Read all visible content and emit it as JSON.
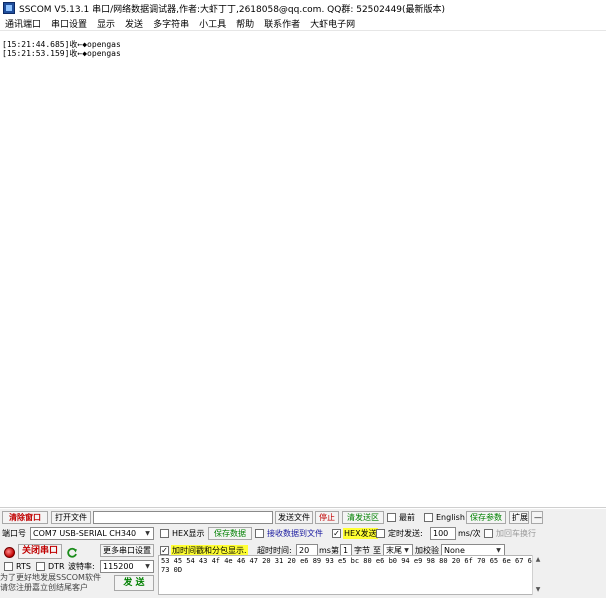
{
  "titlebar": {
    "title": "SSCOM V5.13.1 串口/网络数据调试器,作者:大虾丁丁,2618058@qq.com. QQ群: 52502449(最新版本)"
  },
  "menu": {
    "items": [
      "通讯端口",
      "串口设置",
      "显示",
      "发送",
      "多字符串",
      "小工具",
      "帮助",
      "联系作者",
      "大虾电子网"
    ]
  },
  "receive": {
    "lines": [
      "[15:21:44.685]收←◆opengas",
      "[15:21:53.159]收←◆opengas"
    ]
  },
  "toolbar_row": {
    "clear_window": "清除窗口",
    "open_file": "打开文件",
    "file_path": "",
    "send_file": "发送文件",
    "stop": "停止",
    "clear_send": "清发送区",
    "front": "最前",
    "english": "English",
    "save_params": "保存参数",
    "expand": "扩展",
    "collapse": "—"
  },
  "port": {
    "label": "端口号",
    "value": "COM7 USB-SERIAL CH340",
    "close_port": "关闭串口",
    "more_settings": "更多串口设置",
    "rts": "RTS",
    "dtr": "DTR",
    "baud_label": "波特率:",
    "baud_value": "115200"
  },
  "options": {
    "hex_display": "HEX显示",
    "save_data": "保存数据",
    "recv_to_file": "接收数据到文件",
    "hex_send": "HEX发送",
    "timed_send": "定时发送:",
    "timed_interval": "100",
    "ms_per": "ms/次",
    "add_crlf": "加回车换行",
    "timestamp_packet": "加时间戳和分包显示.",
    "timeout_label": "超时时间:",
    "timeout_value": "20",
    "ms": "ms",
    "byte_prefix": "第",
    "byte_index": "1",
    "byte_suffix": "字节",
    "to": "至",
    "end": "末尾",
    "checksum_label": "加校验",
    "checksum_value": "None"
  },
  "send": {
    "content": "53 45 54 43 4f 4e 46 47 20 31 20 e6 89 93 e5 bc 80 e6 b0 94 e9 98 80 20 6f 70 65 6e 67 61 73 0D",
    "button": "发 送"
  },
  "promo": {
    "line1": "为了更好地发展SSCOM软件",
    "line2": "请您注册嘉立创结尾客户"
  },
  "colors": {
    "led": "#c00000",
    "highlight": "#ffff33",
    "refresh_icon": "#1a8c1a"
  },
  "icons": {
    "app": "sscom-app-icon",
    "led": "port-status-led",
    "refresh": "refresh-icon"
  }
}
